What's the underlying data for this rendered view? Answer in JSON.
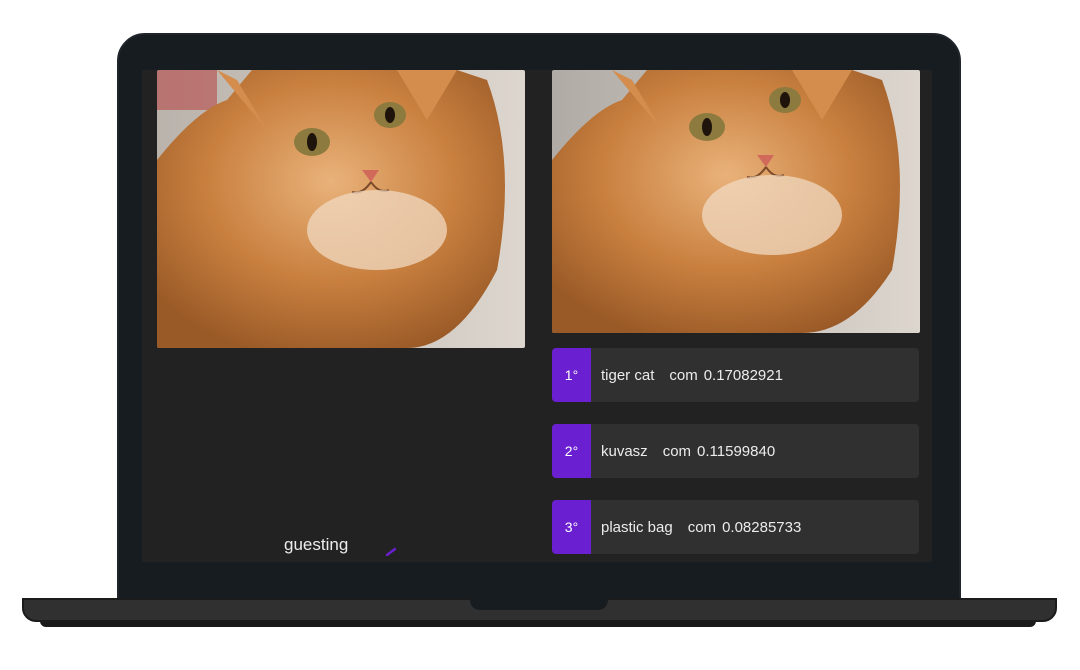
{
  "screen": {
    "accent_color": "#6a1fd0",
    "left_image": "orange-tabby-cat-photo",
    "right_image": "orange-tabby-cat-photo",
    "status_text": "guesting",
    "predictions": [
      {
        "rank": "1°",
        "label": "tiger cat",
        "connector": "com",
        "score": "0.17082921"
      },
      {
        "rank": "2°",
        "label": "kuvasz",
        "connector": "com",
        "score": "0.11599840"
      },
      {
        "rank": "3°",
        "label": "plastic bag",
        "connector": "com",
        "score": "0.08285733"
      }
    ]
  }
}
